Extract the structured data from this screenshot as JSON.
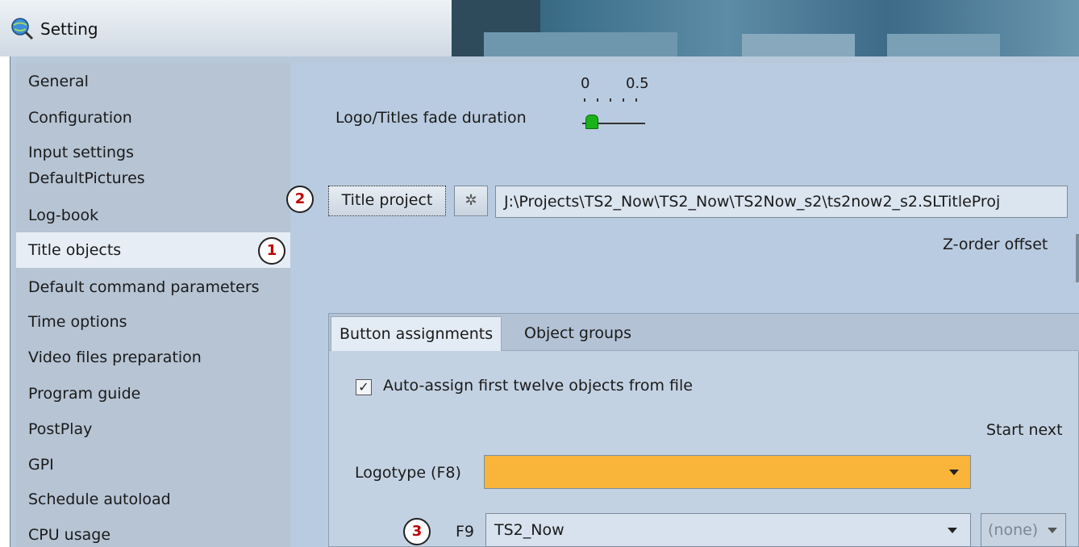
{
  "window": {
    "title": "Setting"
  },
  "sidebar": {
    "items": [
      {
        "label": "General"
      },
      {
        "label": "Configuration"
      },
      {
        "label": "Input settings"
      },
      {
        "label": "DefaultPictures"
      },
      {
        "label": "Log-book"
      },
      {
        "label": "Title objects"
      },
      {
        "label": "Default command parameters"
      },
      {
        "label": "Time options"
      },
      {
        "label": "Video files preparation"
      },
      {
        "label": "Program guide"
      },
      {
        "label": "PostPlay"
      },
      {
        "label": "GPI"
      },
      {
        "label": "Schedule autoload"
      },
      {
        "label": "CPU usage"
      }
    ],
    "selected": "Title objects"
  },
  "fade": {
    "label": "Logo/Titles fade duration",
    "scale_min": "0",
    "scale_max": "0.5",
    "value": 0
  },
  "title_project": {
    "button_label": "Title project",
    "clear_icon": "sparkle-clear-icon",
    "path": "J:\\Projects\\TS2_Now\\TS2_Now\\TS2Now_s2\\ts2now2_s2.SLTitleProj"
  },
  "zorder": {
    "label": "Z-order offset"
  },
  "tabs": [
    {
      "label": "Button assignments",
      "active": true
    },
    {
      "label": "Object groups",
      "active": false
    }
  ],
  "auto_assign": {
    "label": "Auto-assign first twelve objects from file",
    "checked": true
  },
  "start_next": {
    "label": "Start next"
  },
  "logotype": {
    "label": "Logotype (F8)",
    "value": "",
    "color": "#F9B43A"
  },
  "f9": {
    "label": "F9",
    "value": "TS2_Now",
    "secondary": "(none)"
  },
  "callouts": [
    "1",
    "2",
    "3"
  ]
}
